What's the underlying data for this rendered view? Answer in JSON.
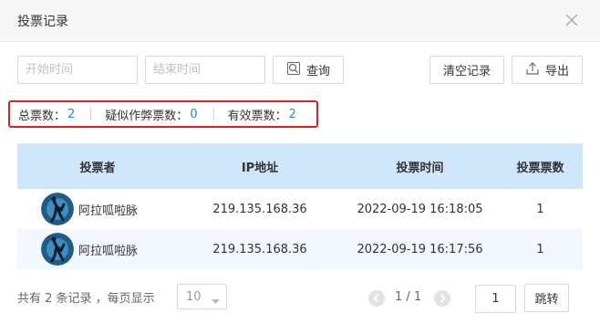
{
  "dialog": {
    "title": "投票记录"
  },
  "filters": {
    "start_placeholder": "开始时间",
    "end_placeholder": "结束时间",
    "query_label": "查询",
    "clear_label": "清空记录",
    "export_label": "导出"
  },
  "stats": [
    {
      "label": "总票数：",
      "value": "2"
    },
    {
      "label": "疑似作弊票数：",
      "value": "0"
    },
    {
      "label": "有效票数：",
      "value": "2"
    }
  ],
  "table": {
    "columns": [
      "投票者",
      "IP地址",
      "投票时间",
      "投票票数"
    ],
    "rows": [
      {
        "voter": "阿拉呱啦脉",
        "ip": "219.135.168.36",
        "time": "2022-09-19 16:18:05",
        "votes": "1"
      },
      {
        "voter": "阿拉呱啦脉",
        "ip": "219.135.168.36",
        "time": "2022-09-19 16:17:56",
        "votes": "1"
      }
    ]
  },
  "pagination": {
    "summary": "共有 2 条记录 ，每页显示",
    "page_size": "10",
    "page_indicator": "1 / 1",
    "jump_value": "1",
    "jump_label": "跳转"
  },
  "colors": {
    "accent": "#1e88e5",
    "highlight_border": "#e02020",
    "header_bg": "#cfe6fb",
    "alt_row": "#f2f8fe"
  },
  "icons": [
    "close-icon",
    "search-icon",
    "export-icon",
    "caret-down-icon",
    "chevron-left-icon",
    "chevron-right-icon"
  ]
}
